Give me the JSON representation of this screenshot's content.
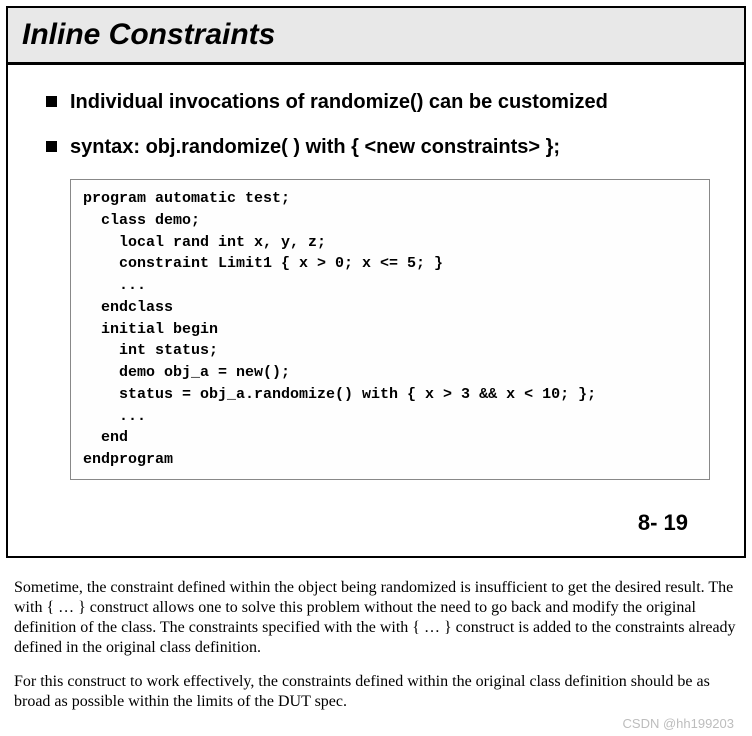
{
  "slide": {
    "title": "Inline Constraints",
    "bullets": [
      "Individual invocations of randomize() can be customized",
      "syntax: obj.randomize( ) with { <new constraints> };"
    ],
    "code": "program automatic test;\n  class demo;\n    local rand int x, y, z;\n    constraint Limit1 { x > 0; x <= 5; }\n    ...\n  endclass\n  initial begin\n    int status;\n    demo obj_a = new();\n    status = obj_a.randomize() with { x > 3 && x < 10; };\n    ...\n  end\nendprogram",
    "page_number": "8- 19"
  },
  "notes": {
    "p1": "Sometime, the constraint defined within the object being randomized is insufficient to get the desired result.  The with { … } construct allows one to solve this problem without the need to go back and modify the original definition of the class.  The constraints specified with the with { … } construct is added to the constraints already defined in the original class definition.",
    "p2": "For this construct to work effectively, the constraints defined within the original class definition should be as broad as possible within the limits of the DUT spec."
  },
  "watermark": "CSDN @hh199203"
}
